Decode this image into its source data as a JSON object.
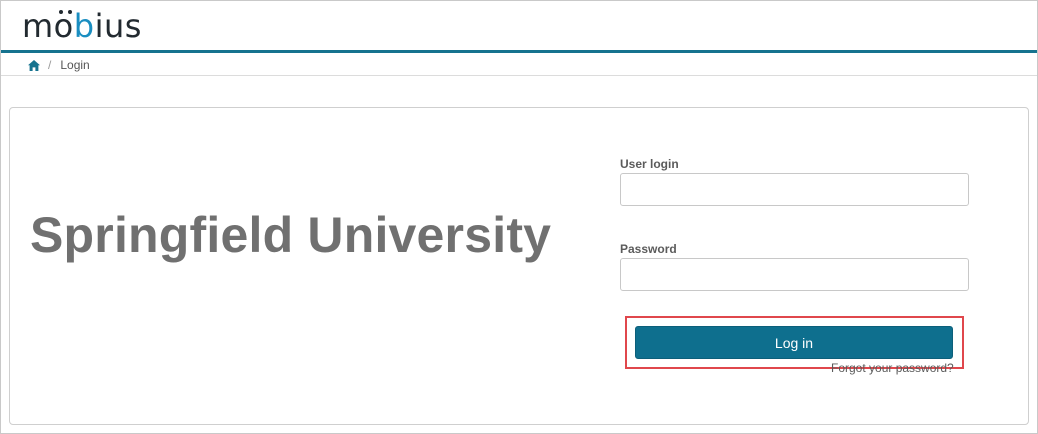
{
  "header": {
    "logo_text_start": "m",
    "logo_text_o": "o",
    "logo_text_accent": "b",
    "logo_text_end": "ius",
    "accent_color": "#1a8ec1",
    "bar_color": "#16738f"
  },
  "breadcrumb": {
    "home_icon": "home-icon",
    "separator": "/",
    "current": "Login"
  },
  "main": {
    "institution": "Springfield University"
  },
  "login_form": {
    "username_label": "User login",
    "username_value": "",
    "password_label": "Password",
    "password_value": "",
    "submit_label": "Log in",
    "submit_color": "#0e6f8e",
    "highlight_color": "#e0474c",
    "forgot_link": "Forgot your password?"
  }
}
